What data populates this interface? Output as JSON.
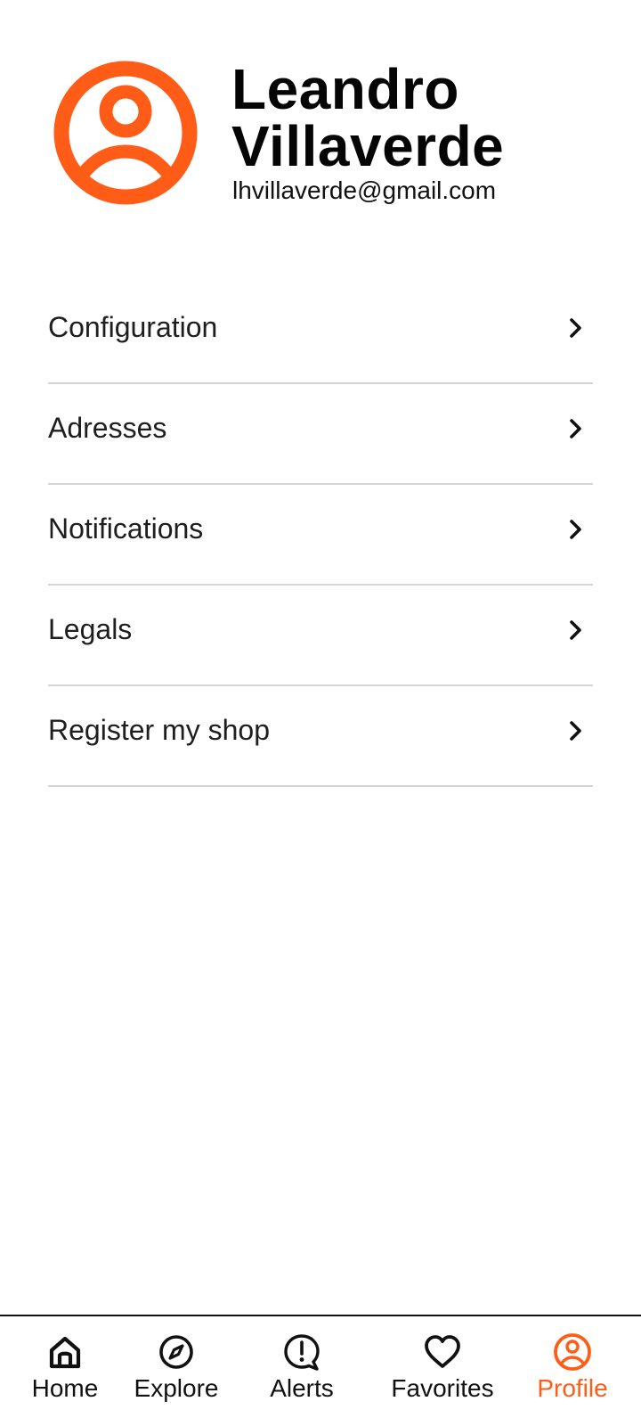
{
  "theme": {
    "accent_color": "#FF5C17",
    "text_color": "#111111",
    "divider_color": "#D5D5D5"
  },
  "profile": {
    "name": "Leandro Villaverde",
    "email": "lhvillaverde@gmail.com",
    "avatar_icon": "user-circle-icon"
  },
  "menu": {
    "items": [
      {
        "label": "Configuration",
        "icon": "chevron-right-icon"
      },
      {
        "label": "Adresses",
        "icon": "chevron-right-icon"
      },
      {
        "label": "Notifications",
        "icon": "chevron-right-icon"
      },
      {
        "label": "Legals",
        "icon": "chevron-right-icon"
      },
      {
        "label": "Register my shop",
        "icon": "chevron-right-icon"
      }
    ]
  },
  "bottom_nav": {
    "active": "Profile",
    "items": [
      {
        "label": "Home",
        "icon": "home-icon"
      },
      {
        "label": "Explore",
        "icon": "compass-icon"
      },
      {
        "label": "Alerts",
        "icon": "alert-bubble-icon"
      },
      {
        "label": "Favorites",
        "icon": "heart-icon"
      },
      {
        "label": "Profile",
        "icon": "user-circle-icon"
      }
    ]
  }
}
